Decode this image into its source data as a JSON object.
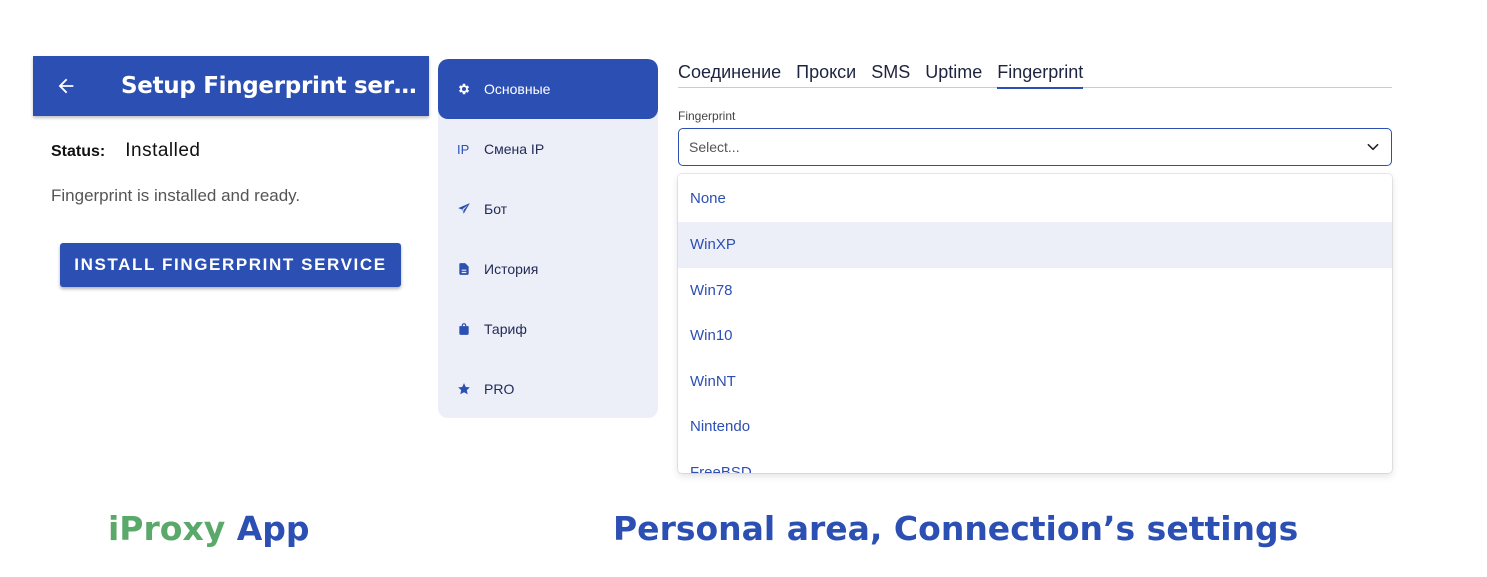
{
  "app": {
    "title": "Setup Fingerprint servi...",
    "status_label": "Status:",
    "status_value": "Installed",
    "description": "Fingerprint is installed and ready.",
    "install_button": "INSTALL FINGERPRINT SERVICE",
    "back_icon": "arrow-left-icon"
  },
  "sidebar": {
    "items": [
      {
        "label": "Основные",
        "icon": "gear-icon",
        "active": true
      },
      {
        "label": "Смена IP",
        "icon_text": "IP"
      },
      {
        "label": "Бот",
        "icon": "paper-plane-icon"
      },
      {
        "label": "История",
        "icon": "document-icon"
      },
      {
        "label": "Тариф",
        "icon": "bag-icon"
      },
      {
        "label": "PRO",
        "icon": "star-icon"
      }
    ]
  },
  "tabs": [
    {
      "label": "Соединение"
    },
    {
      "label": "Прокси"
    },
    {
      "label": "SMS"
    },
    {
      "label": "Uptime"
    },
    {
      "label": "Fingerprint",
      "active": true
    }
  ],
  "fingerprint": {
    "label": "Fingerprint",
    "placeholder": "Select...",
    "options": [
      "None",
      "WinXP",
      "Win78",
      "Win10",
      "WinNT",
      "Nintendo",
      "FreeBSD"
    ],
    "highlighted": "WinXP"
  },
  "captions": {
    "app_part1": "iProxy",
    "app_part2": " App",
    "area": "Personal area, Connection’s settings"
  },
  "colors": {
    "primary": "#2c4fb3",
    "sidebar_bg": "#eceef8",
    "caption_green": "#5ba86b"
  }
}
